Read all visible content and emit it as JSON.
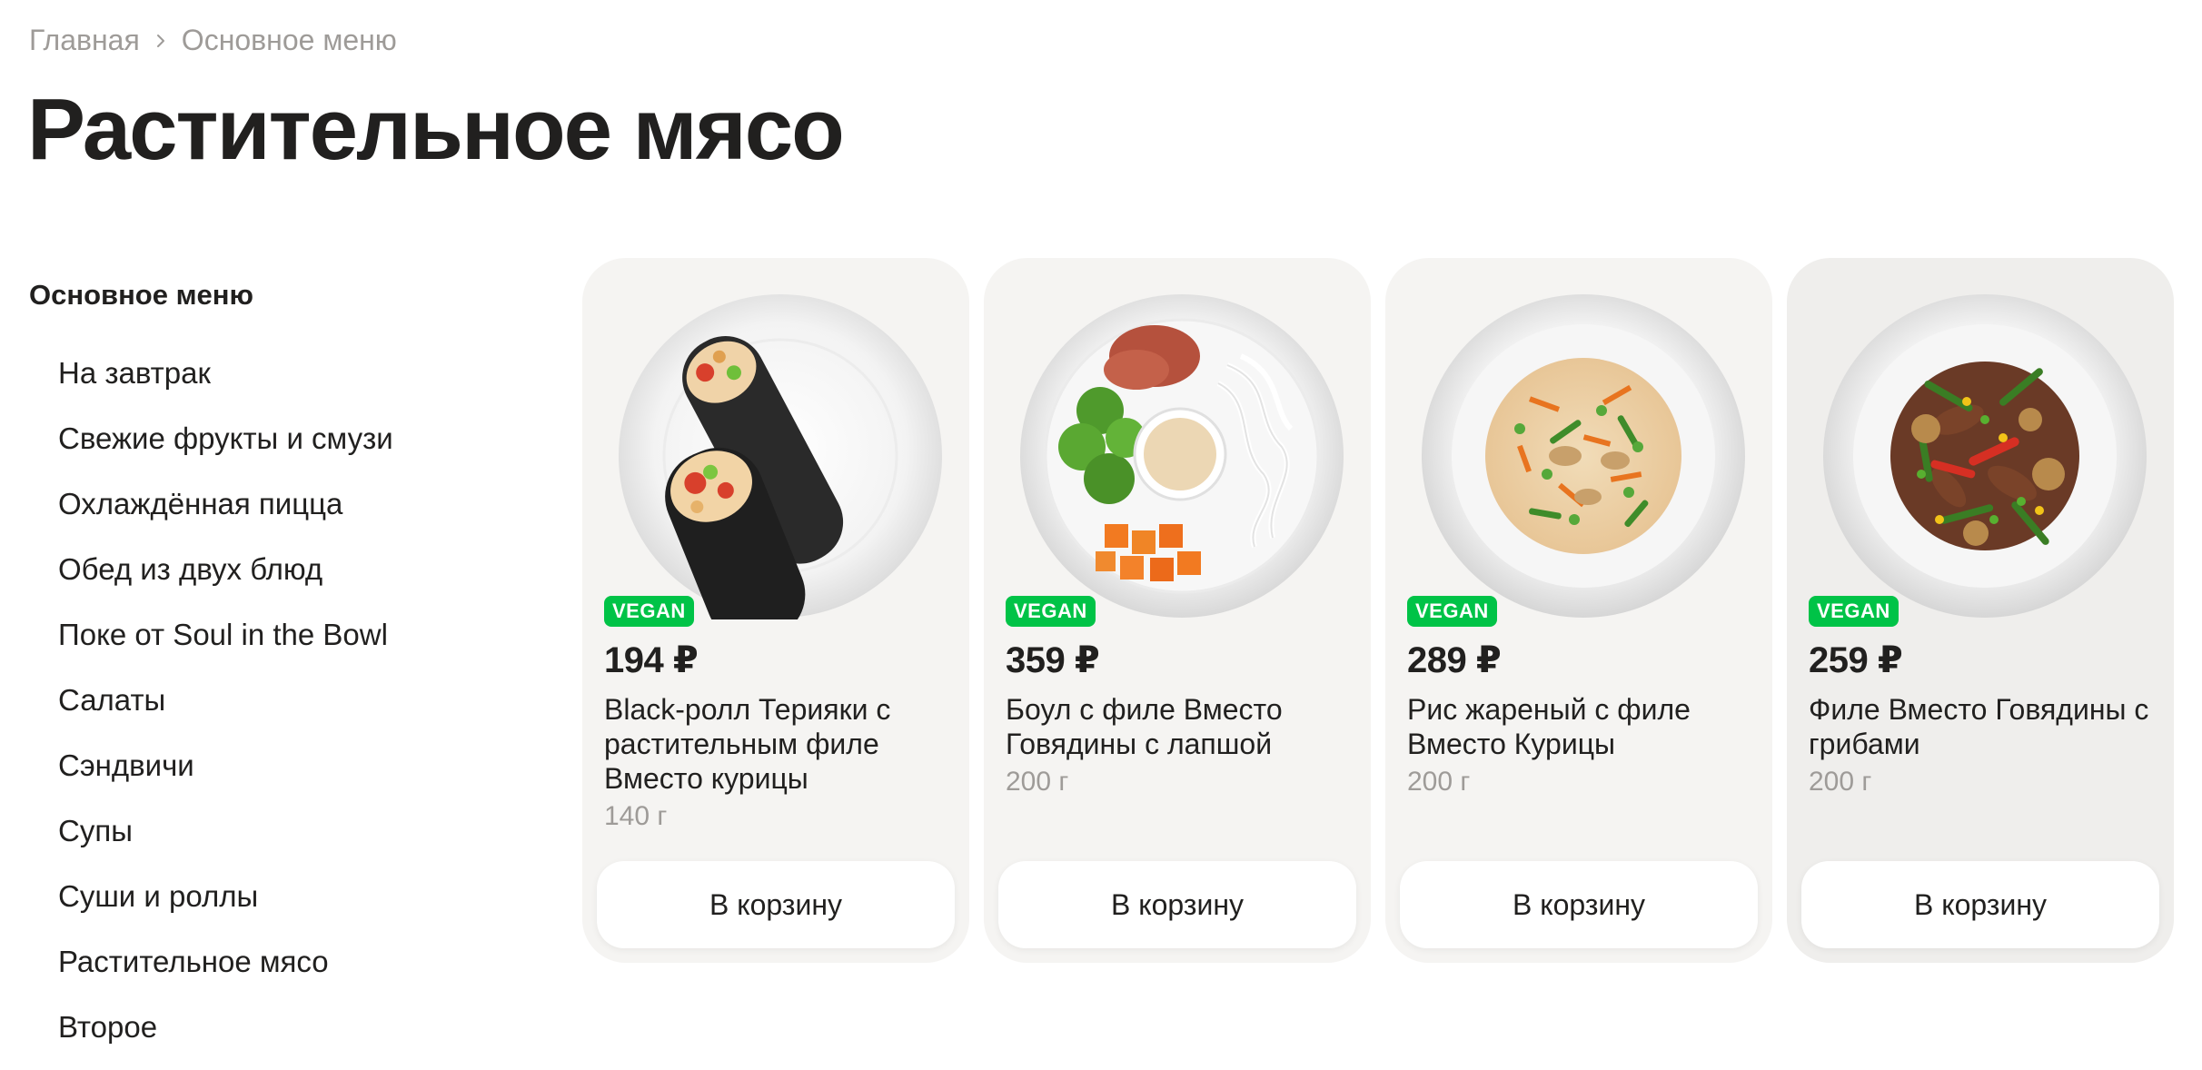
{
  "breadcrumb": {
    "items": [
      "Главная",
      "Основное меню"
    ]
  },
  "page_title": "Растительное мясо",
  "sidebar": {
    "heading": "Основное меню",
    "items": [
      {
        "label": "На завтрак"
      },
      {
        "label": "Свежие фрукты и смузи"
      },
      {
        "label": "Охлаждённая пицца"
      },
      {
        "label": "Обед из двух блюд"
      },
      {
        "label": "Поке от Soul in the Bowl"
      },
      {
        "label": "Салаты"
      },
      {
        "label": "Сэндвичи"
      },
      {
        "label": "Супы"
      },
      {
        "label": "Суши и роллы"
      },
      {
        "label": "Растительное мясо"
      },
      {
        "label": "Второе"
      }
    ]
  },
  "products": [
    {
      "badge": "VEGAN",
      "price": "194 ₽",
      "name": "Black-ролл Терияки с растительным филе Вместо курицы",
      "weight": "140 г",
      "button": "В корзину",
      "image_icon": "wrap-dish-image"
    },
    {
      "badge": "VEGAN",
      "price": "359 ₽",
      "name": "Боул с филе Вместо Говядины с лапшой",
      "weight": "200 г",
      "button": "В корзину",
      "image_icon": "bowl-dish-image"
    },
    {
      "badge": "VEGAN",
      "price": "289 ₽",
      "name": "Рис жареный с филе Вместо Курицы",
      "weight": "200 г",
      "button": "В корзину",
      "image_icon": "rice-dish-image"
    },
    {
      "badge": "VEGAN",
      "price": "259 ₽",
      "name": "Филе Вместо Говядины с грибами",
      "weight": "200 г",
      "button": "В корзину",
      "image_icon": "beef-mushroom-dish-image"
    }
  ],
  "colors": {
    "text": "#21201f",
    "muted": "#9e9b98",
    "card_bg": "#f5f4f2",
    "vegan_badge": "#00c347"
  }
}
